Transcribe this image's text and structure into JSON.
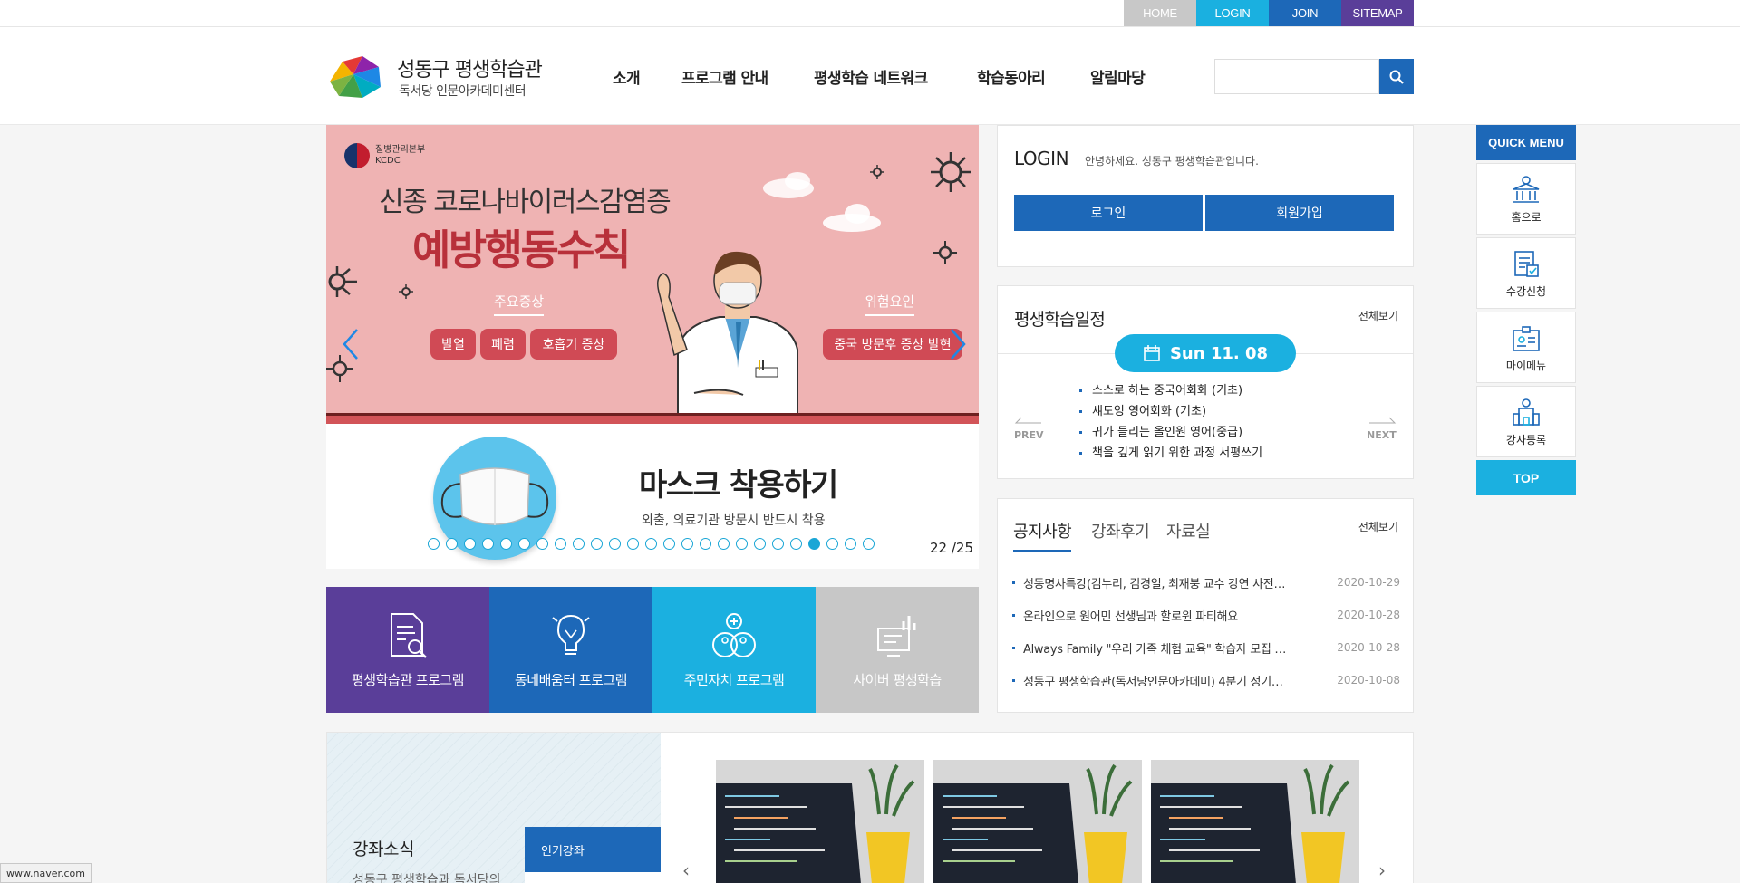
{
  "topbar": {
    "home": "HOME",
    "login": "LOGIN",
    "join": "JOIN",
    "sitemap": "SITEMAP"
  },
  "header": {
    "logo_title": "성동구 평생학습관",
    "logo_sub": "독서당 인문아카데미센터",
    "nav": [
      "소개",
      "프로그램 안내",
      "평생학습 네트워크",
      "학습동아리",
      "알림마당"
    ],
    "search_placeholder": "",
    "search_icon": "search-icon"
  },
  "hero": {
    "org": "질병관리본부",
    "org_en": "KCDC",
    "heading": "신종 코로나바이러스감염증",
    "heading_strong": "예방행동수칙",
    "symptom_label": "주요증상",
    "symptoms": [
      "발열",
      "폐렴",
      "호흡기 증상"
    ],
    "risk_label": "위험요인",
    "risk": "중국 방문후 증상 발현",
    "bottom_title": "마스크 착용하기",
    "bottom_sub": "외출, 의료기관 방문시 반드시 착용",
    "current": 22,
    "total": 25,
    "counter": "22 /25",
    "accent": "#1aa6d6"
  },
  "programs": [
    {
      "label": "평생학습관 프로그램",
      "color": "#5a3e99",
      "icon": "document-search-icon"
    },
    {
      "label": "동네배움터 프로그램",
      "color": "#1d68b8",
      "icon": "lightbulb-icon"
    },
    {
      "label": "주민자치 프로그램",
      "color": "#1bb0e0",
      "icon": "community-icon"
    },
    {
      "label": "사이버 평생학습",
      "color": "#c7c7c7",
      "icon": "monitor-chart-icon"
    }
  ],
  "login_panel": {
    "title": "LOGIN",
    "message": "안녕하세요. 성동구 평생학습관입니다.",
    "login_button": "로그인",
    "signup_button": "회원가입"
  },
  "schedule": {
    "title": "평생학습일정",
    "more": "전체보기",
    "date": "Sun 11. 08",
    "prev": "PREV",
    "next": "NEXT",
    "items": [
      "스스로 하는 중국어회화 (기초)",
      "섀도잉 영어회화 (기초)",
      "귀가 들리는 올인원 영어(중급)",
      "책을 깊게 읽기 위한 과정 서평쓰기"
    ]
  },
  "notice": {
    "tabs": [
      "공지사항",
      "강좌후기",
      "자료실"
    ],
    "more": "전체보기",
    "rows": [
      {
        "title": "성동명사특강(김누리, 김경일, 최재붕 교수 강연 사전…",
        "date": "2020-10-29"
      },
      {
        "title": "온라인으로 원어민 선생님과 할로윈 파티해요",
        "date": "2020-10-28"
      },
      {
        "title": "Always Family \"우리 가족 체험 교육\" 학습자 모집 …",
        "date": "2020-10-28"
      },
      {
        "title": "성동구 평생학습관(독서당인문아카데미) 4분기 정기…",
        "date": "2020-10-08"
      }
    ]
  },
  "quick_menu": {
    "title": "QUICK MENU",
    "items": [
      {
        "label": "홈으로",
        "icon": "home-building-icon"
      },
      {
        "label": "수강신청",
        "icon": "application-form-icon"
      },
      {
        "label": "마이메뉴",
        "icon": "id-card-icon"
      },
      {
        "label": "강사등록",
        "icon": "instructor-icon"
      }
    ],
    "top": "TOP"
  },
  "lecture": {
    "title": "강좌소식",
    "desc": "성동구 평생학습과 독서당의",
    "tab": "인기강좌"
  },
  "status_url": "www.naver.com"
}
